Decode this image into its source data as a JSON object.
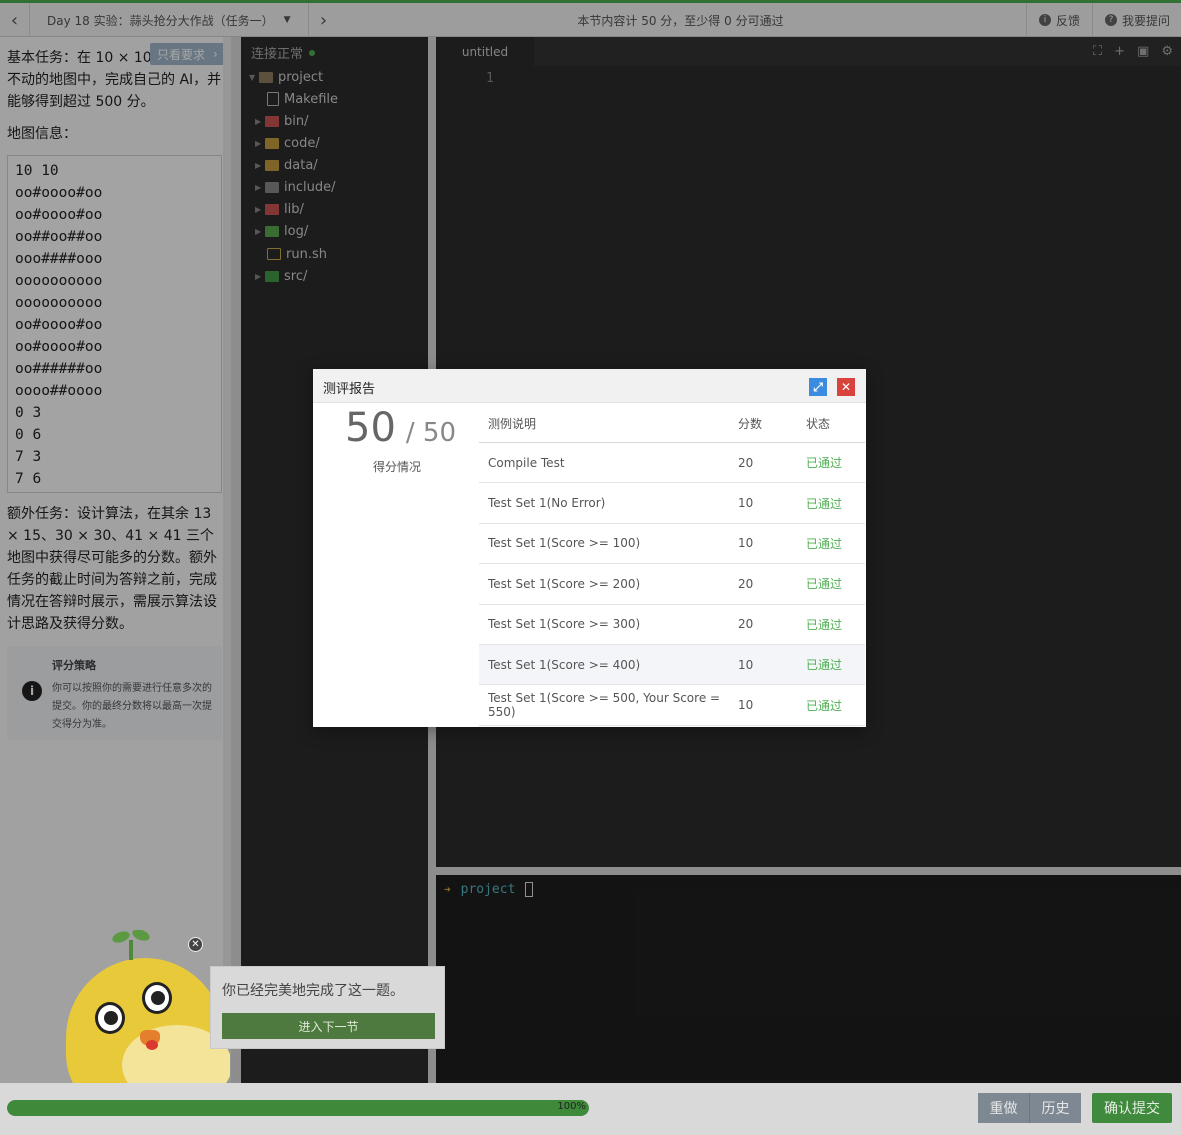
{
  "topbar": {
    "lesson_title": "Day 18 实验：蒜头抢分大作战（任务一）",
    "score_hint": "本节内容计 50 分，至少得 0 分可通过",
    "feedback_label": "反馈",
    "ask_label": "我要提问"
  },
  "description": {
    "task_text": "基本任务：在 10 × 10 …动，AI 不动的地图中，完成自己的 AI，并能够得到超过 500 分。",
    "req_tag": "只看要求",
    "map_title": "地图信息：",
    "map_lines": [
      "10 10",
      "oo#oooo#oo",
      "oo#oooo#oo",
      "oo##oo##oo",
      "ooo####ooo",
      "oooooooooo",
      "oooooooooo",
      "oo#oooo#oo",
      "oo#oooo#oo",
      "oo######oo",
      "oooo##oooo",
      "0 3",
      "0 6",
      "7 3",
      "7 6"
    ],
    "extra_text": "额外任务：设计算法，在其余 13 × 15、30 × 30、41 × 41 三个地图中获得尽可能多的分数。额外任务的截止时间为答辩之前，完成情况在答辩时展示，需展示算法设计思路及获得分数。",
    "policy_title": "评分策略",
    "policy_body": "你可以按照你的需要进行任意多次的提交。你的最终分数将以最高一次提交得分为准。"
  },
  "filetree": {
    "status": "连接正常",
    "items": [
      {
        "label": "project",
        "icon": "folder",
        "expanded": true
      },
      {
        "label": "Makefile",
        "icon": "doc"
      },
      {
        "label": "bin/",
        "icon": "bin"
      },
      {
        "label": "code/",
        "icon": "code"
      },
      {
        "label": "data/",
        "icon": "data"
      },
      {
        "label": "include/",
        "icon": "include"
      },
      {
        "label": "lib/",
        "icon": "lib"
      },
      {
        "label": "log/",
        "icon": "log"
      },
      {
        "label": "run.sh",
        "icon": "sh"
      },
      {
        "label": "src/",
        "icon": "src"
      }
    ]
  },
  "editor": {
    "tab_label": "untitled",
    "line_number": "1"
  },
  "terminal": {
    "prompt": "project"
  },
  "report": {
    "title": "测评报告",
    "score": "50",
    "total": "/ 50",
    "score_label": "得分情况",
    "headers": {
      "desc": "测例说明",
      "score": "分数",
      "status": "状态"
    },
    "rows": [
      {
        "desc": "Compile Test",
        "score": "20",
        "status": "已通过"
      },
      {
        "desc": "Test Set 1(No Error)",
        "score": "10",
        "status": "已通过"
      },
      {
        "desc": "Test Set 1(Score >= 100)",
        "score": "10",
        "status": "已通过"
      },
      {
        "desc": "Test Set 1(Score >= 200)",
        "score": "20",
        "status": "已通过"
      },
      {
        "desc": "Test Set 1(Score >= 300)",
        "score": "20",
        "status": "已通过"
      },
      {
        "desc": "Test Set 1(Score >= 400)",
        "score": "10",
        "status": "已通过"
      },
      {
        "desc": "Test Set 1(Score >= 500, Your Score = 550)",
        "score": "10",
        "status": "已通过"
      }
    ]
  },
  "toast": {
    "message": "你已经完美地完成了这一题。",
    "next_label": "进入下一节"
  },
  "bottombar": {
    "progress": 1.0,
    "progress_text": "100%",
    "redo_label": "重做",
    "history_label": "历史",
    "submit_label": "确认提交"
  },
  "colors": {
    "accent": "#4caf50",
    "pass": "#4caf50",
    "close": "#d9433d",
    "expand": "#3b8be0"
  }
}
